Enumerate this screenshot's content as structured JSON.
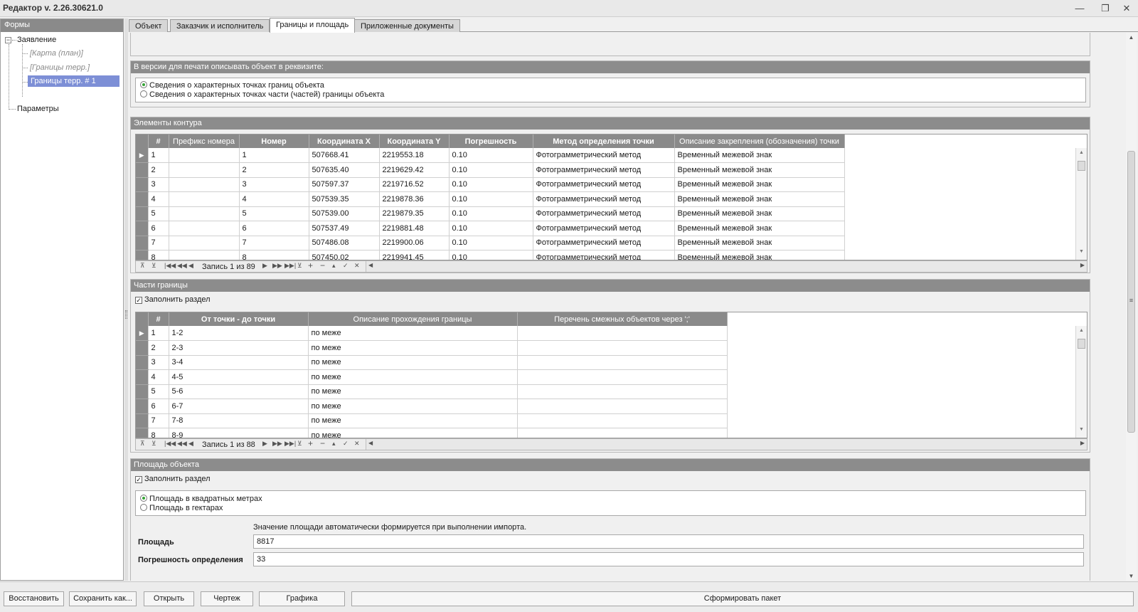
{
  "window": {
    "title": "Редактор v. 2.26.30621.0",
    "controls": [
      "—",
      "❐",
      "✕"
    ]
  },
  "left_pane": {
    "header": "Формы",
    "tree": {
      "root": "Заявление",
      "children": [
        "[Карта (план)]",
        "[Границы терр.]",
        "Границы терр. # 1"
      ],
      "sibling": "Параметры"
    }
  },
  "tabs": [
    "Объект",
    "Заказчик и исполнитель",
    "Границы и площадь",
    "Приложенные документы"
  ],
  "active_tab": "Границы и площадь",
  "print_section": {
    "header": "В версии для печати описывать объект в реквизите:",
    "options": [
      "Сведения о характерных точках границ объекта",
      "Сведения о характерных точках части (частей) границы объекта"
    ],
    "selected": 0
  },
  "contour": {
    "header": "Элементы контура",
    "columns": [
      "#",
      "Префикс номера",
      "Номер",
      "Координата X",
      "Координата Y",
      "Погрешность",
      "Метод определения точки",
      "Описание закрепления (обозначения) точки"
    ],
    "rows": [
      [
        "1",
        "",
        "1",
        "507668.41",
        "2219553.18",
        "0.10",
        "Фотограмметрический метод",
        "Временный межевой знак"
      ],
      [
        "2",
        "",
        "2",
        "507635.40",
        "2219629.42",
        "0.10",
        "Фотограмметрический метод",
        "Временный межевой знак"
      ],
      [
        "3",
        "",
        "3",
        "507597.37",
        "2219716.52",
        "0.10",
        "Фотограмметрический метод",
        "Временный межевой знак"
      ],
      [
        "4",
        "",
        "4",
        "507539.35",
        "2219878.36",
        "0.10",
        "Фотограмметрический метод",
        "Временный межевой знак"
      ],
      [
        "5",
        "",
        "5",
        "507539.00",
        "2219879.35",
        "0.10",
        "Фотограмметрический метод",
        "Временный межевой знак"
      ],
      [
        "6",
        "",
        "6",
        "507537.49",
        "2219881.48",
        "0.10",
        "Фотограмметрический метод",
        "Временный межевой знак"
      ],
      [
        "7",
        "",
        "7",
        "507486.08",
        "2219900.06",
        "0.10",
        "Фотограмметрический метод",
        "Временный межевой знак"
      ],
      [
        "8",
        "",
        "8",
        "507450.02",
        "2219941.45",
        "0.10",
        "Фотограмметрический метод",
        "Временный межевой знак"
      ]
    ],
    "record": "Запись 1 из 89"
  },
  "parts": {
    "header": "Части границы",
    "fill_label": "Заполнить раздел",
    "columns": [
      "#",
      "От точки - до точки",
      "Описание прохождения границы",
      "Перечень смежных объектов через ';'"
    ],
    "rows": [
      [
        "1",
        "1-2",
        "по меже",
        ""
      ],
      [
        "2",
        "2-3",
        "по меже",
        ""
      ],
      [
        "3",
        "3-4",
        "по меже",
        ""
      ],
      [
        "4",
        "4-5",
        "по меже",
        ""
      ],
      [
        "5",
        "5-6",
        "по меже",
        ""
      ],
      [
        "6",
        "6-7",
        "по меже",
        ""
      ],
      [
        "7",
        "7-8",
        "по меже",
        ""
      ],
      [
        "8",
        "8-9",
        "по меже",
        ""
      ]
    ],
    "record": "Запись 1 из 88"
  },
  "area": {
    "header": "Площадь объекта",
    "fill_label": "Заполнить раздел",
    "options": [
      "Площадь в квадратных метрах",
      "Площадь в гектарах"
    ],
    "selected": 0,
    "note": "Значение площади автоматически формируется при выполнении импорта.",
    "area_label": "Площадь",
    "area_value": "8817",
    "error_label": "Погрешность определения",
    "error_value": "33"
  },
  "bottom_buttons": [
    "Восстановить",
    "Сохранить как...",
    "Открыть",
    "Чертеж",
    "Графика",
    "Сформировать пакет"
  ]
}
